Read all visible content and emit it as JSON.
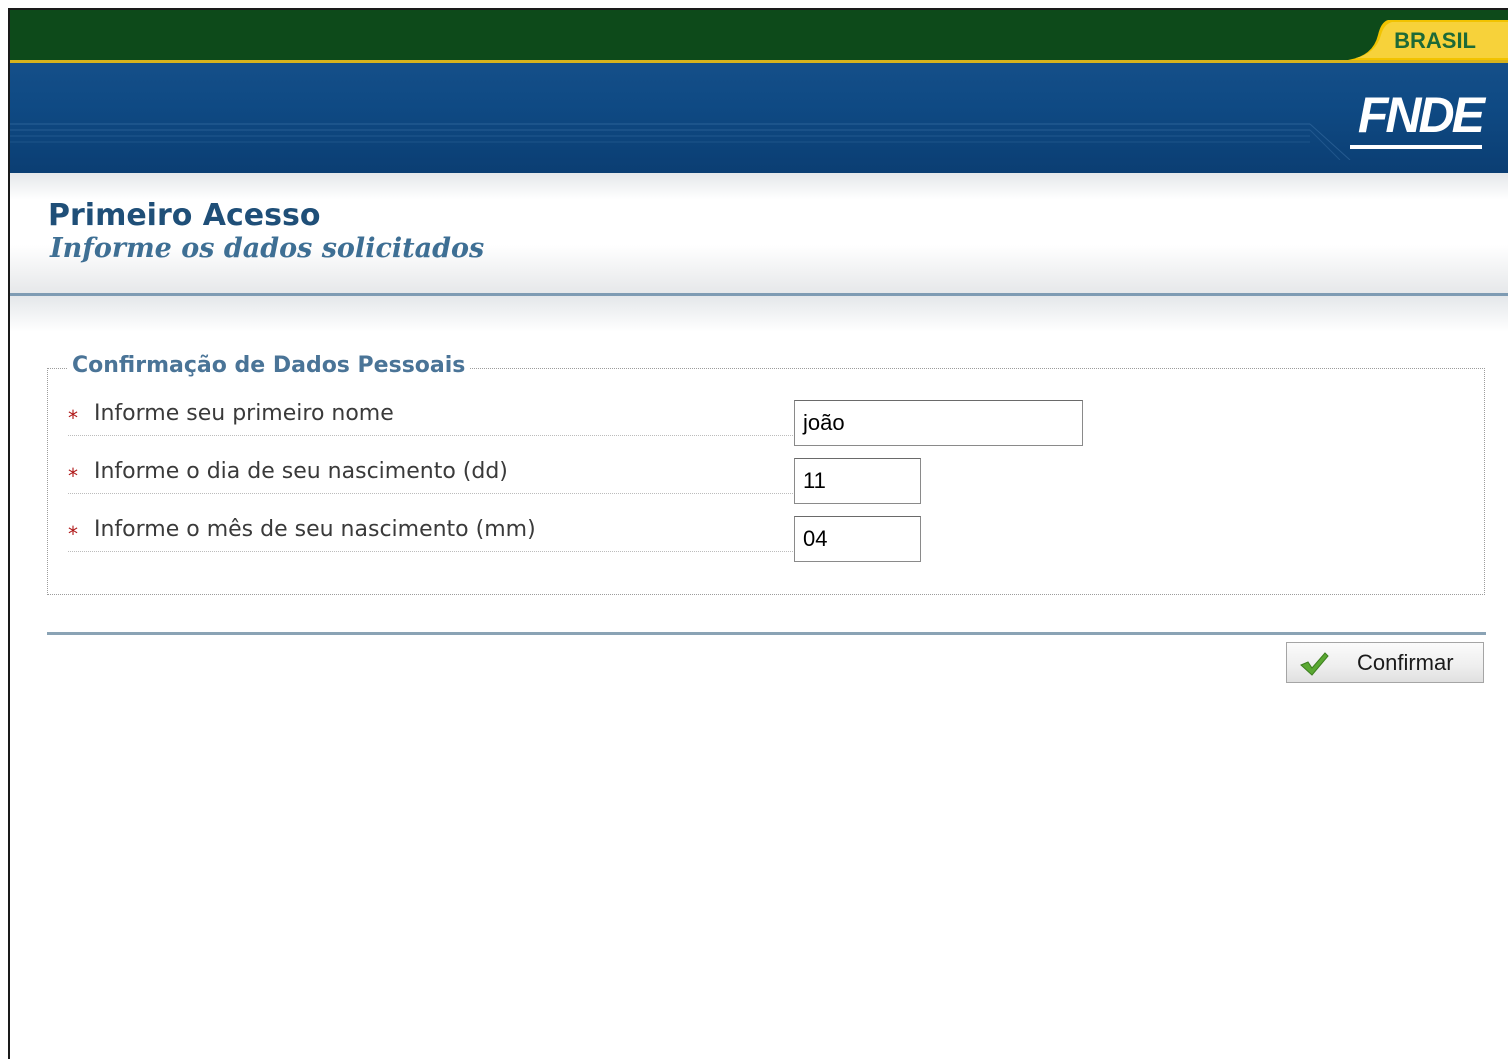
{
  "header": {
    "brasil_label": "BRASIL",
    "logo_text": "FNDE",
    "colors": {
      "gov_bar": "#0d4a1a",
      "header_blue": "#0f4a84",
      "brasil_yellow": "#f2c300",
      "brasil_green": "#1d6a37"
    }
  },
  "page": {
    "title": "Primeiro Acesso",
    "subtitle": "Informe os dados solicitados"
  },
  "form": {
    "legend": "Confirmação de Dados Pessoais",
    "required_marker": "*",
    "fields": [
      {
        "label": "Informe seu primeiro nome",
        "value": "joão"
      },
      {
        "label": "Informe o dia de seu nascimento (dd)",
        "value": "11"
      },
      {
        "label": "Informe o mês de seu nascimento (mm)",
        "value": "04"
      }
    ],
    "confirm_label": "Confirmar",
    "confirm_icon": "check-icon"
  }
}
